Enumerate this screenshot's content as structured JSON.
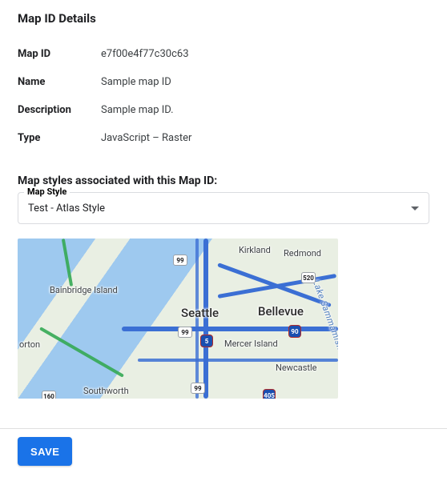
{
  "section_title": "Map ID Details",
  "details": {
    "rows": [
      {
        "label": "Map ID",
        "value": "e7f00e4f77c30c63"
      },
      {
        "label": "Name",
        "value": "Sample map ID"
      },
      {
        "label": "Description",
        "value": "Sample map ID."
      },
      {
        "label": "Type",
        "value": "JavaScript – Raster"
      }
    ]
  },
  "assoc_title": "Map styles associated with this Map ID:",
  "map_style": {
    "label": "Map Style",
    "selected": "Test - Atlas Style"
  },
  "map_preview": {
    "labels": {
      "seattle": "Seattle",
      "bellevue": "Bellevue",
      "kirkland": "Kirkland",
      "redmond": "Redmond",
      "mercer_island": "Mercer Island",
      "newcastle": "Newcastle",
      "bainbridge_island": "Bainbridge Island",
      "southworth": "Southworth",
      "lake_sammamish": "Lake Sammamish",
      "orton": "orton"
    },
    "shields": {
      "i5": "5",
      "i90": "90",
      "sr99_a": "99",
      "sr99_b": "99",
      "sr99_c": "99",
      "sr520": "520",
      "i405": "405",
      "sr160": "160"
    }
  },
  "actions": {
    "save_label": "SAVE"
  }
}
